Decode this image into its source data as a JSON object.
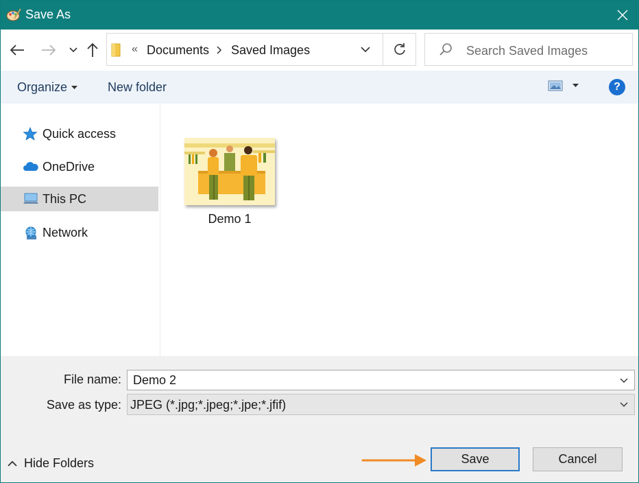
{
  "window": {
    "title": "Save As",
    "title_bar_color": "#0f7f7d"
  },
  "nav": {
    "back_icon": "back-arrow-icon",
    "forward_icon": "forward-arrow-icon",
    "recent_icon": "chevron-down-icon",
    "up_icon": "up-arrow-icon",
    "address": {
      "overflow": "«",
      "crumbs": [
        "Documents",
        "Saved Images"
      ]
    },
    "search_placeholder": "Search Saved Images"
  },
  "toolbar": {
    "organize_label": "Organize",
    "new_folder_label": "New folder",
    "help_label": "?"
  },
  "sidebar": {
    "items": [
      {
        "label": "Quick access",
        "icon": "star-icon"
      },
      {
        "label": "OneDrive",
        "icon": "cloud-icon"
      },
      {
        "label": "This PC",
        "icon": "computer-icon",
        "selected": true
      },
      {
        "label": "Network",
        "icon": "network-icon"
      }
    ]
  },
  "content": {
    "files": [
      {
        "name": "Demo 1",
        "type": "image"
      }
    ]
  },
  "form": {
    "file_name_label": "File name:",
    "file_name_value": "Demo 2",
    "save_type_label": "Save as type:",
    "save_type_value": "JPEG (*.jpg;*.jpeg;*.jpe;*.jfif)"
  },
  "footer": {
    "hide_folders_label": "Hide Folders",
    "save_label": "Save",
    "cancel_label": "Cancel",
    "arrow_color": "#f08a24",
    "save_border_color": "#2a78c8"
  }
}
